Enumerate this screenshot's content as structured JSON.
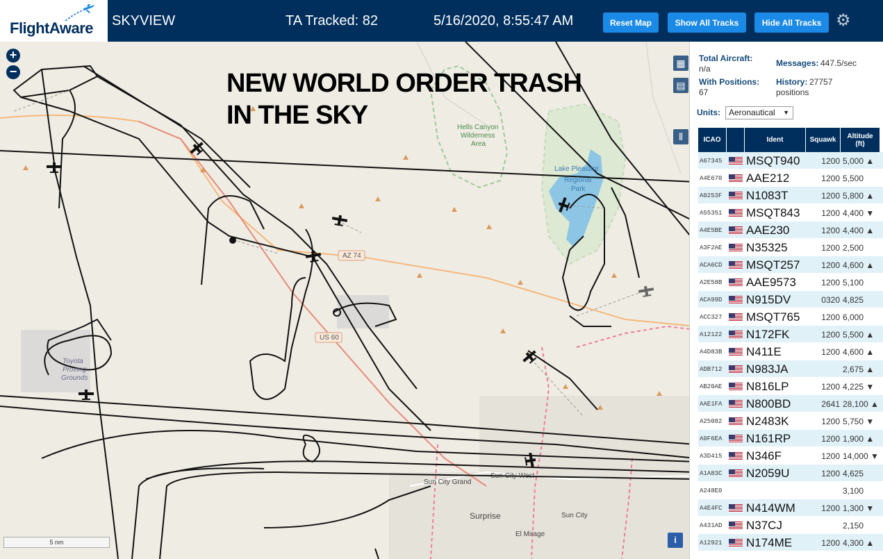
{
  "header": {
    "logo": "FlightAware",
    "app_title": "SKYVIEW",
    "ta_tracked": "TA Tracked: 82",
    "datetime": "5/16/2020, 8:55:47 AM",
    "reset_map": "Reset Map",
    "show_all_tracks": "Show All Tracks",
    "hide_all_tracks": "Hide All Tracks",
    "settings_icon": "gear-icon"
  },
  "map": {
    "overlay_line1": "NEW WORLD ORDER TRASH",
    "overlay_line2": "IN THE SKY",
    "scale": "5 nm",
    "info": "i",
    "zoom_in": "+",
    "zoom_out": "−",
    "labels": {
      "hells_canyon": "Hells Canyon",
      "wilderness": "Wilderness",
      "area": "Area",
      "lake_pleasant": "Lake Pleasant",
      "regional": "Regional",
      "park": "Park",
      "az74": "AZ 74",
      "us60": "US 60",
      "toyota": "Toyota",
      "proving": "Proving",
      "grounds": "Grounds",
      "sun_city_grand": "Sun City Grand",
      "sun_city_west": "Sun City West",
      "surprise": "Surprise",
      "sun_city": "Sun City",
      "el_mirage": "El Mirage"
    }
  },
  "panel": {
    "total_aircraft_label": "Total Aircraft:",
    "total_aircraft_value": "n/a",
    "messages_label": "Messages:",
    "messages_value": "447.5/sec",
    "with_positions_label": "With Positions:",
    "with_positions_value": "67",
    "history_label": "History:",
    "history_value": "27757",
    "history_unit": "positions",
    "units_label": "Units:",
    "units_value": "Aeronautical"
  },
  "table": {
    "headers": {
      "icao": "ICAO",
      "ident": "Ident",
      "squawk": "Squawk",
      "alt_line1": "Altitude",
      "alt_line2": "(ft)"
    },
    "rows": [
      {
        "icao": "A67345",
        "flag": true,
        "ident": "MSQT940",
        "squawk": "1200",
        "alt": "5,000 ▲"
      },
      {
        "icao": "A4E670",
        "flag": true,
        "ident": "AAE212",
        "squawk": "1200",
        "alt": "5,500"
      },
      {
        "icao": "A0253F",
        "flag": true,
        "ident": "N1083T",
        "squawk": "1200",
        "alt": "5,800 ▲"
      },
      {
        "icao": "A55351",
        "flag": true,
        "ident": "MSQT843",
        "squawk": "1200",
        "alt": "4,400 ▼"
      },
      {
        "icao": "A4E5BE",
        "flag": true,
        "ident": "AAE230",
        "squawk": "1200",
        "alt": "4,400 ▲"
      },
      {
        "icao": "A3F2AE",
        "flag": true,
        "ident": "N35325",
        "squawk": "1200",
        "alt": "2,500"
      },
      {
        "icao": "ACA6CD",
        "flag": true,
        "ident": "MSQT257",
        "squawk": "1200",
        "alt": "4,600 ▲"
      },
      {
        "icao": "A2E58B",
        "flag": true,
        "ident": "AAE9573",
        "squawk": "1200",
        "alt": "5,100"
      },
      {
        "icao": "ACA99D",
        "flag": true,
        "ident": "N915DV",
        "squawk": "0320",
        "alt": "4,825"
      },
      {
        "icao": "ACC327",
        "flag": true,
        "ident": "MSQT765",
        "squawk": "1200",
        "alt": "6,000"
      },
      {
        "icao": "A12122",
        "flag": true,
        "ident": "N172FK",
        "squawk": "1200",
        "alt": "5,500 ▲"
      },
      {
        "icao": "A4D83B",
        "flag": true,
        "ident": "N411E",
        "squawk": "1200",
        "alt": "4,600 ▲"
      },
      {
        "icao": "ADB712",
        "flag": true,
        "ident": "N983JA",
        "squawk": "",
        "alt": "2,675 ▲"
      },
      {
        "icao": "AB20AE",
        "flag": true,
        "ident": "N816LP",
        "squawk": "1200",
        "alt": "4,225 ▼"
      },
      {
        "icao": "AAE1FA",
        "flag": true,
        "ident": "N800BD",
        "squawk": "2641",
        "alt": "28,100 ▲"
      },
      {
        "icao": "A25082",
        "flag": true,
        "ident": "N2483K",
        "squawk": "1200",
        "alt": "5,750 ▼"
      },
      {
        "icao": "A0F6EA",
        "flag": true,
        "ident": "N161RP",
        "squawk": "1200",
        "alt": "1,900 ▲"
      },
      {
        "icao": "A3D415",
        "flag": true,
        "ident": "N346F",
        "squawk": "1200",
        "alt": "14,000 ▼"
      },
      {
        "icao": "A1A83C",
        "flag": true,
        "ident": "N2059U",
        "squawk": "1200",
        "alt": "4,625"
      },
      {
        "icao": "A248E0",
        "flag": false,
        "ident": "",
        "squawk": "",
        "alt": "3,100"
      },
      {
        "icao": "A4E4FC",
        "flag": true,
        "ident": "N414WM",
        "squawk": "1200",
        "alt": "1,300 ▼"
      },
      {
        "icao": "A431AD",
        "flag": true,
        "ident": "N37CJ",
        "squawk": "",
        "alt": "2,150"
      },
      {
        "icao": "A12921",
        "flag": true,
        "ident": "N174ME",
        "squawk": "1200",
        "alt": "4,300 ▲"
      }
    ]
  }
}
